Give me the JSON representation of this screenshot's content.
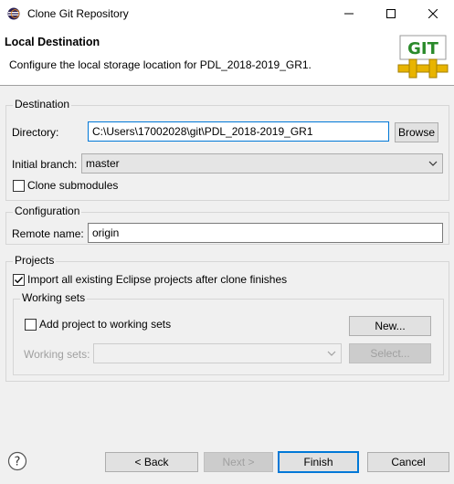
{
  "window": {
    "title": "Clone Git Repository"
  },
  "banner": {
    "title": "Local Destination",
    "description": "Configure the local storage location for PDL_2018-2019_GR1.",
    "logo_text": "GIT"
  },
  "destination": {
    "group_title": "Destination",
    "directory_label": "Directory:",
    "directory_value": "C:\\Users\\17002028\\git\\PDL_2018-2019_GR1",
    "browse_label": "Browse",
    "branch_label": "Initial branch:",
    "branch_value": "master",
    "clone_submodules_label": "Clone submodules",
    "clone_submodules_checked": false
  },
  "configuration": {
    "group_title": "Configuration",
    "remote_label": "Remote name:",
    "remote_value": "origin"
  },
  "projects": {
    "group_title": "Projects",
    "import_label": "Import all existing Eclipse projects after clone finishes",
    "import_checked": true,
    "working_sets": {
      "group_title": "Working sets",
      "add_label": "Add project to working sets",
      "add_checked": false,
      "new_label": "New...",
      "sets_label": "Working sets:",
      "sets_value": "",
      "select_label": "Select..."
    }
  },
  "footer": {
    "back_label": "< Back",
    "next_label": "Next >",
    "finish_label": "Finish",
    "cancel_label": "Cancel"
  },
  "colors": {
    "accent": "#0078d7",
    "logo_green": "#2a8a2a",
    "logo_pipe": "#e8b400"
  }
}
